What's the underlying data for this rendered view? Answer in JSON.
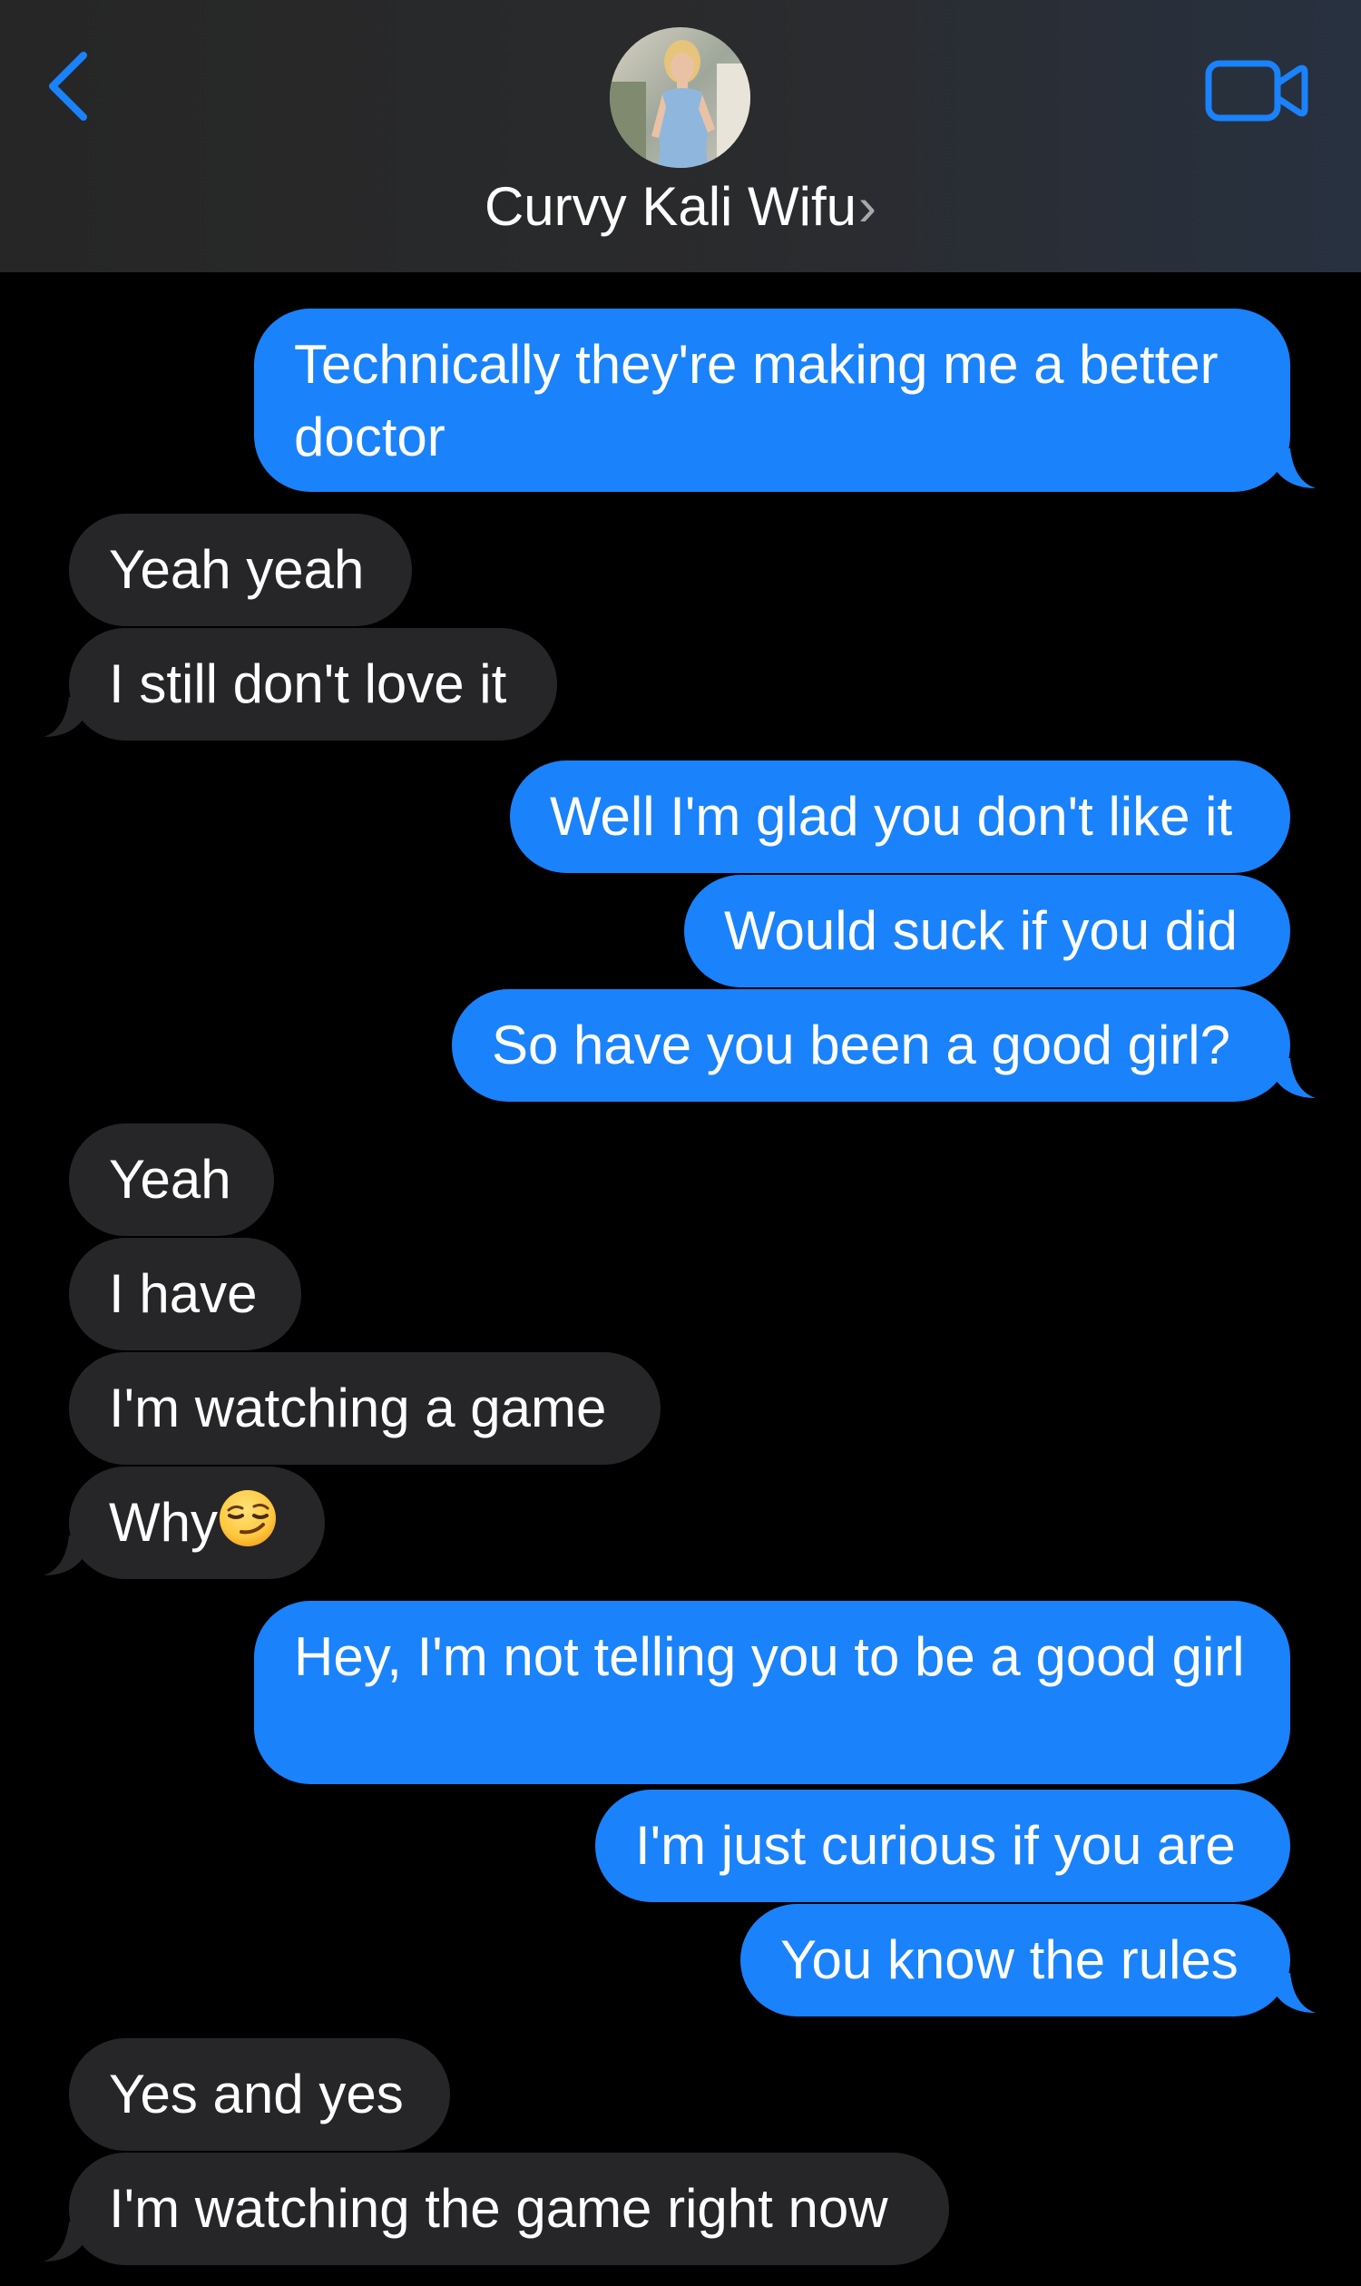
{
  "header": {
    "contact_name": "Curvy Kali Wifu",
    "name_chevron": "›",
    "back_icon": "chevron-left-icon",
    "video_icon": "video-camera-icon",
    "accent_color": "#1a82fb"
  },
  "colors": {
    "sent_bubble": "#1a82fb",
    "received_bubble": "#262628",
    "background": "#000000"
  },
  "messages": [
    {
      "direction": "sent",
      "text": "Technically they're making me a better doctor"
    },
    {
      "direction": "received",
      "text": "Yeah yeah"
    },
    {
      "direction": "received",
      "text": "I still don't love it"
    },
    {
      "direction": "sent",
      "text": "Well I'm glad you don't like it"
    },
    {
      "direction": "sent",
      "text": "Would suck if you did"
    },
    {
      "direction": "sent",
      "text": "So have you been a good girl?"
    },
    {
      "direction": "received",
      "text": "Yeah"
    },
    {
      "direction": "received",
      "text": "I have"
    },
    {
      "direction": "received",
      "text": "I'm watching a game"
    },
    {
      "direction": "received",
      "text": "Why",
      "emoji": "smirking-face-emoji"
    },
    {
      "direction": "sent",
      "text": "Hey, I'm not telling you to be a good girl"
    },
    {
      "direction": "sent",
      "text": "I'm just curious if you are"
    },
    {
      "direction": "sent",
      "text": "You know the rules"
    },
    {
      "direction": "received",
      "text": "Yes and yes"
    },
    {
      "direction": "received",
      "text": "I'm watching the game right now"
    }
  ]
}
